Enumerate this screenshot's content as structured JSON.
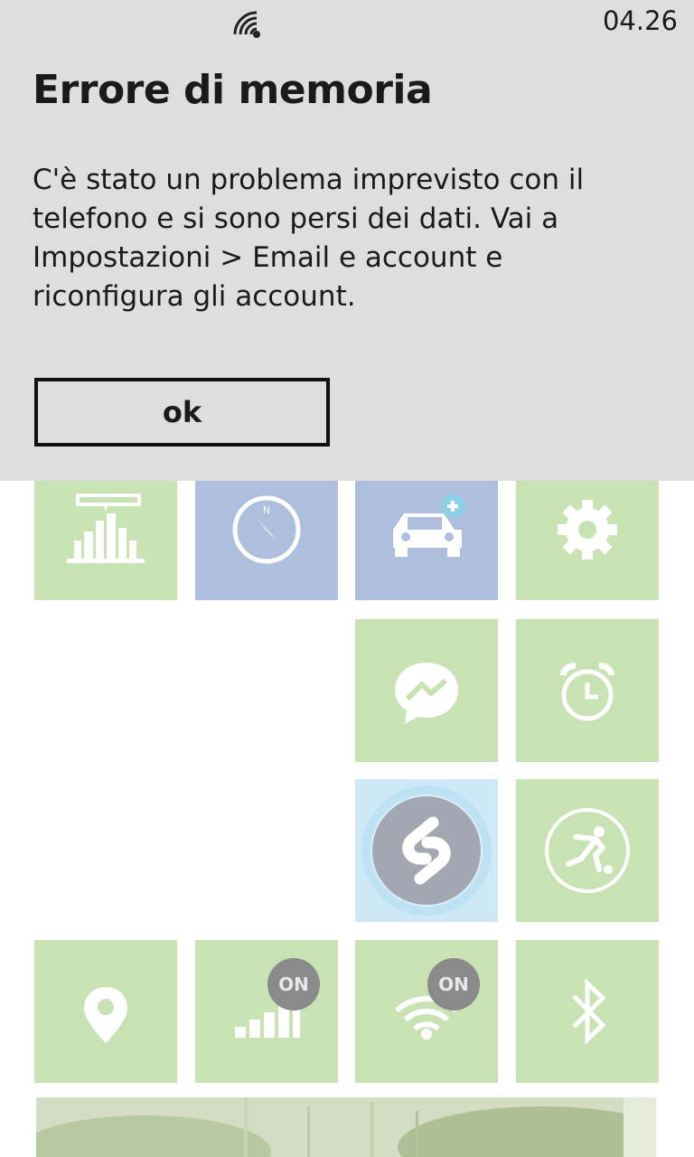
{
  "status_bar": {
    "signal_icon": "signal-strength-icon",
    "time": "04.26"
  },
  "dialog": {
    "title": "Errore di memoria",
    "message": "C'è stato un problema imprevisto con il telefono e si sono persi dei dati. Vai a Impostazioni > Email e account e riconfigura gli account.",
    "ok_label": "ok"
  },
  "tiles": {
    "colors": {
      "green": "#c8e2b4",
      "blue": "#adbfdc",
      "badge": "#8a8a8a"
    },
    "cellular_badge": "ON",
    "wifi_badge": "ON",
    "icons": [
      "city-skyline-icon",
      "compass-icon",
      "car-add-icon",
      "settings-gear-icon",
      "messenger-icon",
      "alarm-clock-icon",
      "shazam-icon",
      "soccer-player-icon",
      "location-pin-icon",
      "cellular-signal-icon",
      "wifi-icon",
      "bluetooth-icon"
    ]
  }
}
